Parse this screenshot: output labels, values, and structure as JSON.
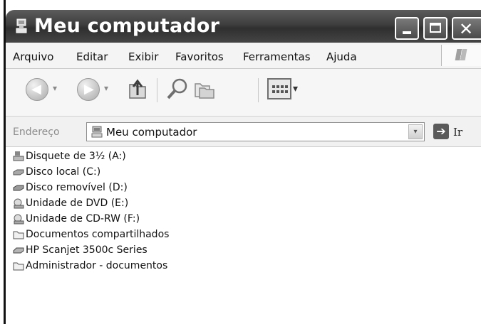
{
  "window": {
    "title": "Meu computador",
    "icons": {
      "title": "my-computer-icon",
      "minimize": "minimize-icon",
      "maximize": "maximize-icon",
      "close": "close-icon"
    },
    "close_glyph": "✕"
  },
  "menu": {
    "items": [
      {
        "label": "Arquivo"
      },
      {
        "label": "Editar"
      },
      {
        "label": "Exibir"
      },
      {
        "label": "Favoritos"
      },
      {
        "label": "Ferramentas"
      },
      {
        "label": "Ajuda"
      }
    ],
    "logo_icon": "windows-logo-icon"
  },
  "toolbar": {
    "back_icon": "back-arrow-icon",
    "forward_icon": "forward-arrow-icon",
    "up_icon": "up-folder-icon",
    "search_icon": "search-icon",
    "folders_icon": "folders-icon",
    "views_icon": "views-icon",
    "dropdown_glyph": "▾",
    "views_dropdown_glyph": "▾"
  },
  "address": {
    "label": "Endereço",
    "value": "Meu computador",
    "dropdown_glyph": "▾",
    "go_glyph": "➔",
    "go_label": "Ir"
  },
  "items": [
    {
      "label": "Disquete de 3½ (A:)",
      "icon": "floppy-drive-icon"
    },
    {
      "label": "Disco local (C:)",
      "icon": "hard-disk-icon"
    },
    {
      "label": "Disco removível (D:)",
      "icon": "removable-disk-icon"
    },
    {
      "label": "Unidade de DVD (E:)",
      "icon": "dvd-drive-icon"
    },
    {
      "label": "Unidade de CD-RW (F:)",
      "icon": "cd-rw-drive-icon"
    },
    {
      "label": "Documentos compartilhados",
      "icon": "shared-folder-icon"
    },
    {
      "label": "HP Scanjet 3500c Series",
      "icon": "scanner-icon"
    },
    {
      "label": "Administrador - documentos",
      "icon": "user-folder-icon"
    }
  ],
  "colors": {
    "titlebar": "#444444",
    "menubar": "#f4f4f4",
    "content": "#ffffff"
  }
}
